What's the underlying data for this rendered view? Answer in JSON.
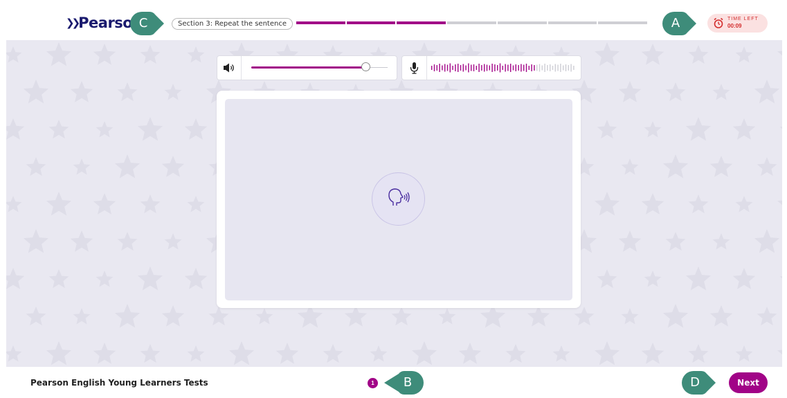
{
  "header": {
    "logo_text": "Pearson",
    "section_label": "Section 3: Repeat the sentence",
    "progress": {
      "total_segments": 7,
      "completed_segments": 3
    },
    "timer": {
      "label": "TIME LEFT",
      "value": "00:09"
    }
  },
  "callouts": {
    "a": "A",
    "b": "B",
    "c": "C",
    "d": "D"
  },
  "controls": {
    "volume_level": 0.84,
    "volume_icon": "speaker-icon",
    "mic_icon": "microphone-icon"
  },
  "card": {
    "icon": "speaking-head-icon"
  },
  "footer": {
    "title": "Pearson English Young Learners Tests",
    "page_number": "1",
    "next_label": "Next"
  },
  "colors": {
    "accent": "#a10387",
    "navy": "#1a1a6e",
    "callout": "#3e8c7a",
    "timer_text": "#d32c2c",
    "timer_bg": "#fbe1e1",
    "stage_bg": "#e9e8f1"
  }
}
